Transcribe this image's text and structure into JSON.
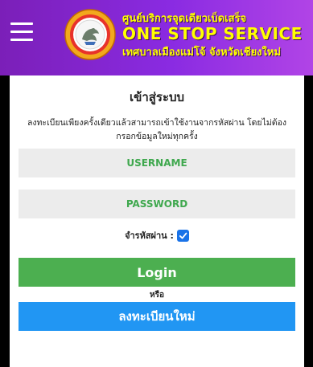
{
  "header": {
    "menu_icon": "hamburger-menu-icon",
    "logo_icon": "municipality-seal-logo",
    "line1": "ศูนย์บริการจุดเดียวเบ็ดเสร็จ",
    "line2": "ONE STOP SERVICE",
    "line3": "เทศบาลเมืองแม่โจ้ จังหวัดเชียงใหม่"
  },
  "login": {
    "title": "เข้าสู่ระบบ",
    "description": "ลงทะเบียนเพียงครั้งเดียวแล้วสามารถเข้าใช้งานจากรหัสผ่าน โดยไม่ต้องกรอกข้อมูลใหม่ทุกครั้ง",
    "username_placeholder": "USERNAME",
    "password_placeholder": "PASSWORD",
    "remember_label": "จำรหัสผ่าน :",
    "remember_checked": true,
    "login_button": "Login",
    "or_text": "หรือ",
    "register_button": "ลงทะเบียนใหม่"
  },
  "colors": {
    "header_gradient_start": "#7b1fb8",
    "header_gradient_end": "#b144e6",
    "header_text": "#ffff00",
    "field_text": "#3fa84e",
    "login_button": "#4caf50",
    "register_button": "#2196f3",
    "checkbox": "#1a73e8"
  }
}
